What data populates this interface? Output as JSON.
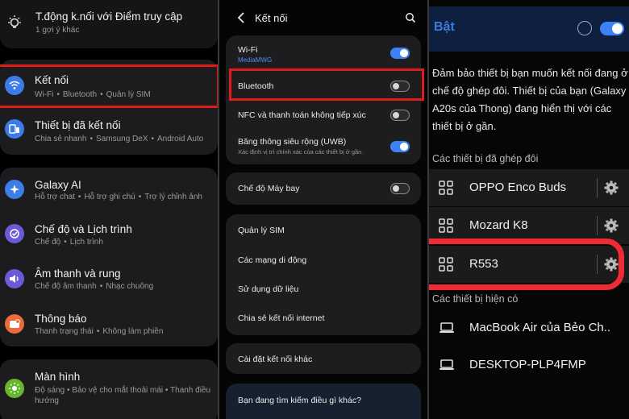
{
  "panel1": {
    "top_item": {
      "title": "T.động k.nối với Điểm truy cập",
      "subtitle": "1 gợi ý khác"
    },
    "items": [
      {
        "title": "Kết nối",
        "subs": [
          "Wi-Fi",
          "Bluetooth",
          "Quản lý SIM"
        ],
        "icon": "wifi-icon",
        "color": "#3d7bea"
      },
      {
        "title": "Thiết bị đã kết nối",
        "subs": [
          "Chia sẻ nhanh",
          "Samsung DeX",
          "Android Auto"
        ],
        "icon": "devices-icon",
        "color": "#3d7bea"
      },
      {
        "title": "Galaxy AI",
        "subs": [
          "Hỗ trợ chat",
          "Hỗ trợ ghi chú",
          "Trợ lý chỉnh ảnh"
        ],
        "icon": "sparkle-icon",
        "color": "#3a7ee8"
      },
      {
        "title": "Chế độ và Lịch trình",
        "subs": [
          "Chế độ",
          "Lịch trình"
        ],
        "icon": "check-circle-icon",
        "color": "#6b5bd6"
      },
      {
        "title": "Âm thanh và rung",
        "subs": [
          "Chế độ âm thanh",
          "Nhạc chuông"
        ],
        "icon": "speaker-icon",
        "color": "#6b5bd6"
      },
      {
        "title": "Thông báo",
        "subs": [
          "Thanh trạng thái",
          "Không làm phiền"
        ],
        "icon": "bell-icon",
        "color": "#ec6b3b"
      },
      {
        "title": "Màn hình",
        "subs_text": "Độ sáng • Bảo vệ cho mắt thoải mái • Thanh điều hướng",
        "icon": "sun-icon",
        "color": "#68b52e"
      }
    ]
  },
  "panel2": {
    "header": {
      "title": "Kết nối"
    },
    "wifi": {
      "title": "Wi-Fi",
      "network": "MediaMWG",
      "on": true
    },
    "bluetooth": {
      "title": "Bluetooth",
      "on": false
    },
    "nfc": {
      "title": "NFC và thanh toán không tiếp xúc",
      "on": false
    },
    "uwb": {
      "title": "Băng thông siêu rộng (UWB)",
      "subtitle": "Xác định vị trí chính xác của các thiết bị ở gần.",
      "on": true
    },
    "airplane": {
      "title": "Chế độ Máy bay",
      "on": false
    },
    "menu": [
      "Quản lý SIM",
      "Các mạng di động",
      "Sử dụng dữ liệu",
      "Chia sẻ kết nối internet"
    ],
    "more": "Cài đặt kết nối khác",
    "suggest": "Bạn đang tìm kiếm điều gì khác?"
  },
  "panel3": {
    "header": {
      "label": "Bật",
      "on": true
    },
    "description": "Đảm bảo thiết bị bạn muốn kết nối đang ở chế độ ghép đôi. Thiết bị của bạn (Galaxy A20s của Thong) đang hiển thị với các thiết bị ở gần.",
    "paired_title": "Các thiết bị đã ghép đôi",
    "paired": [
      "OPPO Enco Buds",
      "Mozard K8",
      "R553"
    ],
    "available_title": "Các thiết bị hiện có",
    "available": [
      "MacBook Air của Bẻo Ch..",
      "DESKTOP-PLP4FMP"
    ]
  },
  "colors": {
    "accent": "#3e82f7",
    "highlight": "#e01b1b"
  }
}
